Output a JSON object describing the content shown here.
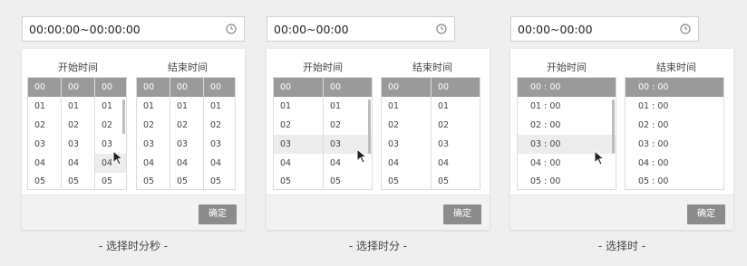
{
  "panels": [
    {
      "input_value": "00:00:00~00:00:00",
      "start_label": "开始时间",
      "end_label": "结束时间",
      "columns": [
        [
          "00",
          "01",
          "02",
          "03",
          "04",
          "05"
        ],
        [
          "00",
          "01",
          "02",
          "03",
          "04",
          "05"
        ],
        [
          "00",
          "01",
          "02",
          "03",
          "04",
          "05"
        ]
      ],
      "confirm_label": "确定",
      "caption": "- 选择时分秒 -"
    },
    {
      "input_value": "00:00~00:00",
      "start_label": "开始时间",
      "end_label": "结束时间",
      "columns": [
        [
          "00",
          "01",
          "02",
          "03",
          "04",
          "05"
        ],
        [
          "00",
          "01",
          "02",
          "03",
          "04",
          "05"
        ]
      ],
      "confirm_label": "确定",
      "caption": "- 选择时分 -"
    },
    {
      "input_value": "00:00~00:00",
      "start_label": "开始时间",
      "end_label": "结束时间",
      "columns": [
        [
          "00 : 00",
          "01 : 00",
          "02 : 00",
          "03 : 00",
          "04 : 00",
          "05 : 00"
        ]
      ],
      "confirm_label": "确定",
      "caption": "- 选择时 -"
    }
  ],
  "icons": {
    "clock": "clock-icon",
    "cursor": "mouse-pointer-icon"
  },
  "colors": {
    "header": "#9a9a9a",
    "confirm": "#8c8c8c",
    "background": "#efefef",
    "hover_row": "#ececec"
  }
}
